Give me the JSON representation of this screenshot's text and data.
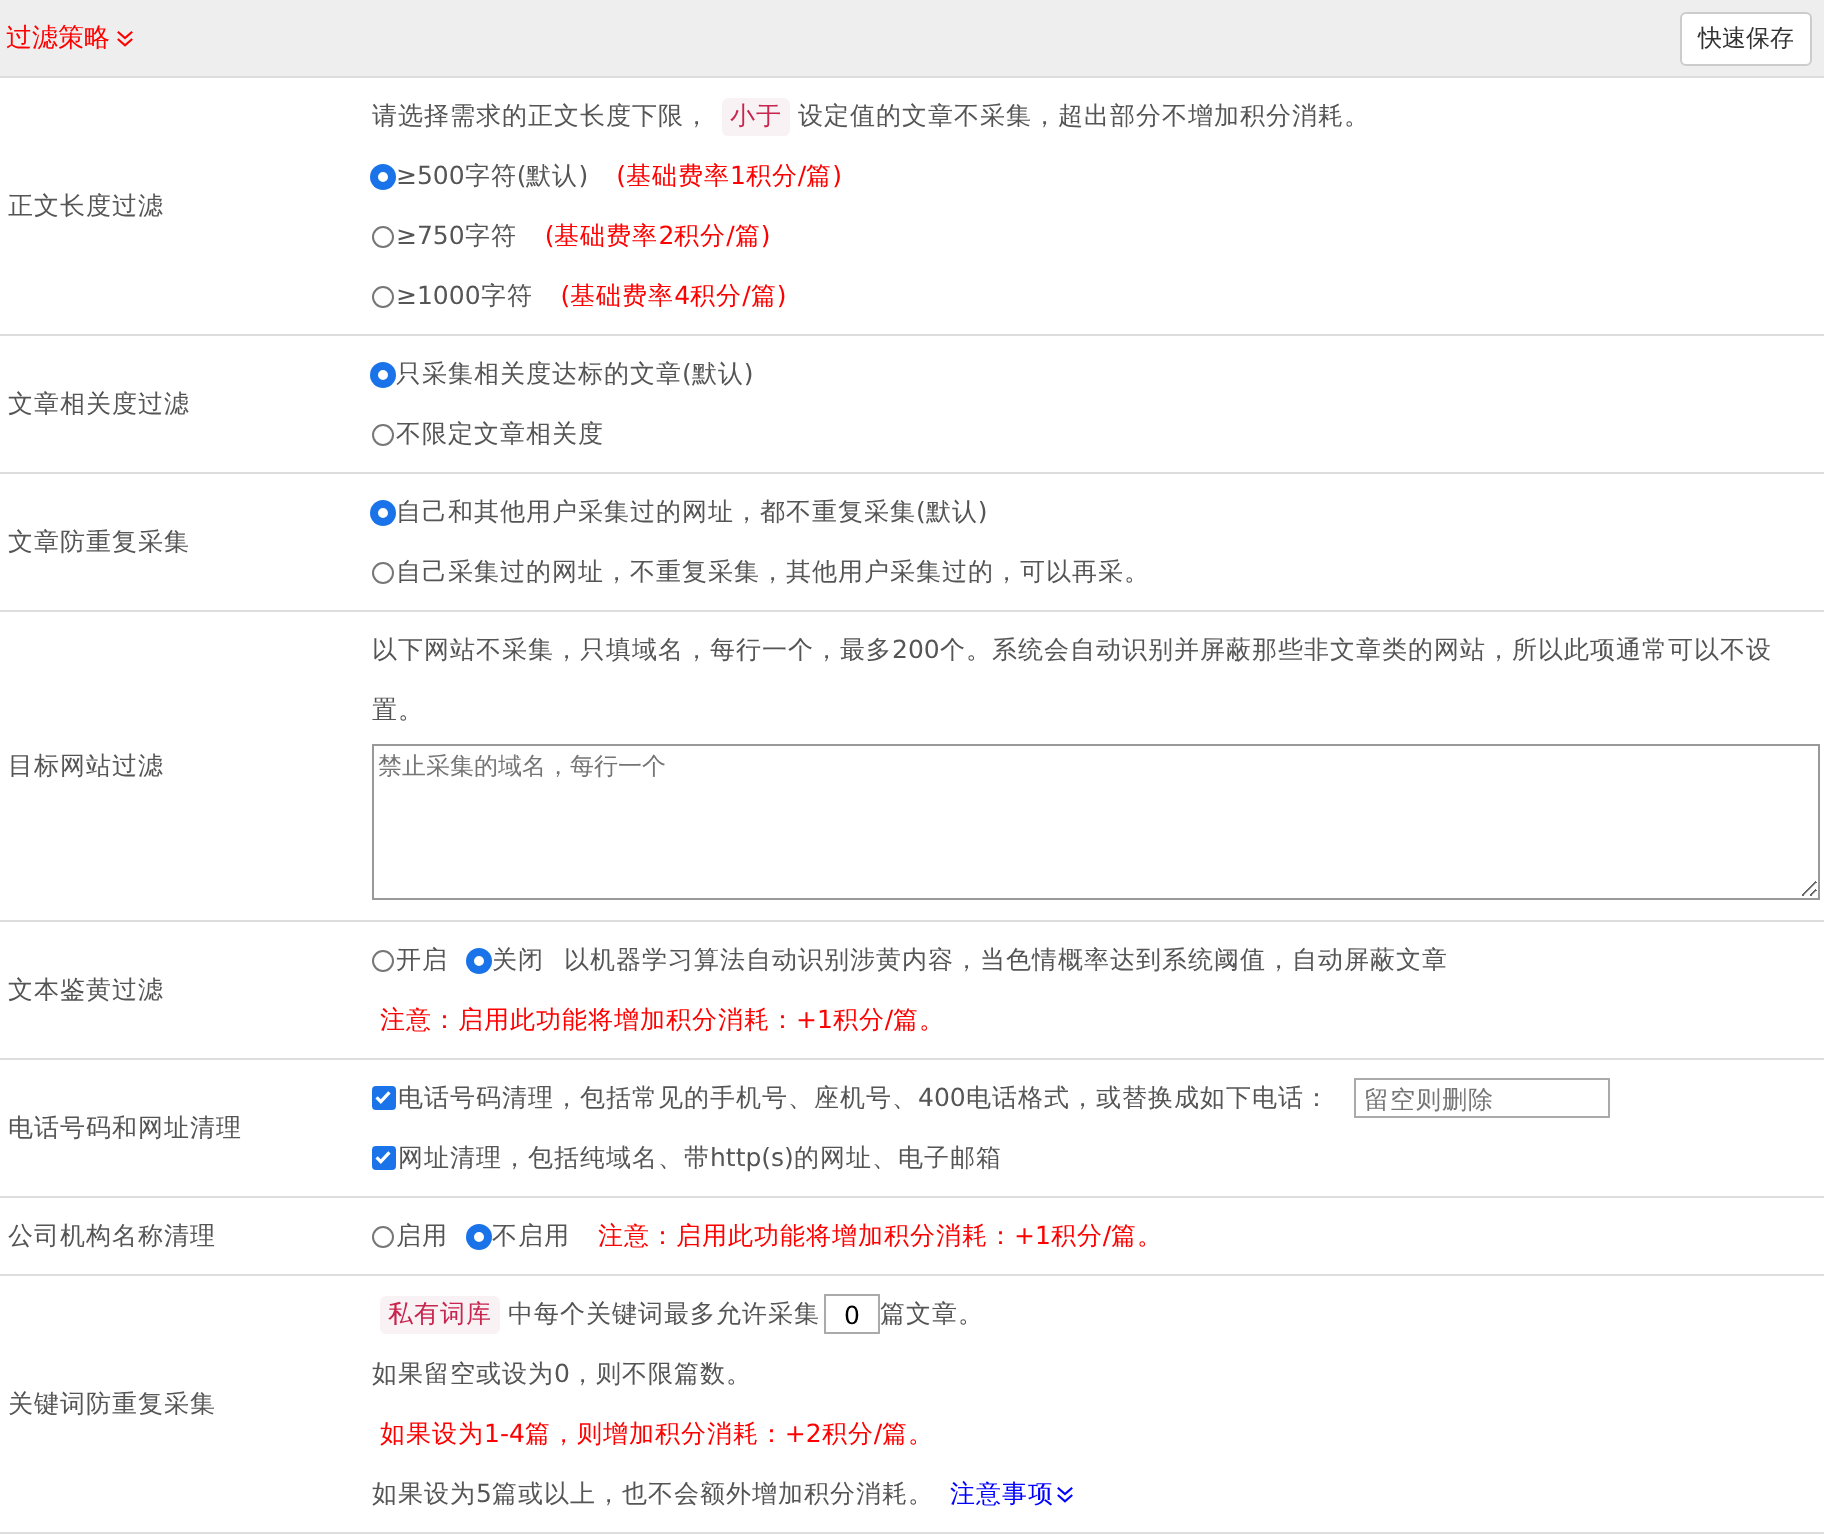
{
  "header": {
    "title": "过滤策略",
    "button": "快速保存"
  },
  "rows": [
    {
      "label": "正文长度过滤",
      "lines": [
        [
          {
            "kind": "text",
            "text": "请选择需求的正文长度下限，"
          },
          {
            "kind": "tag",
            "text": "小于"
          },
          {
            "kind": "text",
            "text": "设定值的文章不采集，超出部分不增加积分消耗。"
          }
        ],
        [
          {
            "kind": "radio",
            "label": "≥500字符(默认)",
            "selected": true
          },
          {
            "kind": "note",
            "text": "(基础费率1积分/篇)"
          }
        ],
        [
          {
            "kind": "radio",
            "label": "≥750字符",
            "selected": false
          },
          {
            "kind": "note",
            "text": "(基础费率2积分/篇)"
          }
        ],
        [
          {
            "kind": "radio",
            "label": "≥1000字符",
            "selected": false
          },
          {
            "kind": "note",
            "text": "(基础费率4积分/篇)"
          }
        ]
      ]
    },
    {
      "label": "文章相关度过滤",
      "lines": [
        [
          {
            "kind": "radio",
            "label": "只采集相关度达标的文章(默认)",
            "selected": true
          }
        ],
        [
          {
            "kind": "radio",
            "label": "不限定文章相关度",
            "selected": false
          }
        ]
      ]
    },
    {
      "label": "文章防重复采集",
      "lines": [
        [
          {
            "kind": "radio",
            "label": "自己和其他用户采集过的网址，都不重复采集(默认)",
            "selected": true
          }
        ],
        [
          {
            "kind": "radio",
            "label": "自己采集过的网址，不重复采集，其他用户采集过的，可以再采。",
            "selected": false
          }
        ]
      ]
    },
    {
      "label": "目标网站过滤",
      "lines": [
        [
          {
            "kind": "text",
            "text": "以下网站不采集，只填域名，每行一个，最多200个。系统会自动识别并屏蔽那些非文章类的网站，所以此项通常可以不设置。"
          }
        ],
        [
          {
            "kind": "textarea",
            "placeholder": "禁止采集的域名，每行一个"
          }
        ]
      ]
    },
    {
      "label": "文本鉴黄过滤",
      "lines": [
        [
          {
            "kind": "radio",
            "label": "开启",
            "selected": false
          },
          {
            "kind": "radio",
            "label": "关闭",
            "selected": true
          },
          {
            "kind": "text",
            "text": "以机器学习算法自动识别涉黄内容，当色情概率达到系统阈值，自动屏蔽文章"
          }
        ],
        [
          {
            "kind": "note",
            "text": "注意：启用此功能将增加积分消耗：+1积分/篇。"
          }
        ]
      ]
    },
    {
      "label": "电话号码和网址清理",
      "lines": [
        [
          {
            "kind": "checkbox",
            "label": "电话号码清理，包括常见的手机号、座机号、400电话格式，或替换成如下电话：",
            "checked": true
          },
          {
            "kind": "input",
            "placeholder": "留空则删除"
          }
        ],
        [
          {
            "kind": "checkbox",
            "label": "网址清理，包括纯域名、带http(s)的网址、电子邮箱",
            "checked": true
          }
        ]
      ]
    },
    {
      "label": "公司机构名称清理",
      "lines": [
        [
          {
            "kind": "radio",
            "label": "启用",
            "selected": false
          },
          {
            "kind": "radio",
            "label": "不启用",
            "selected": true
          },
          {
            "kind": "note",
            "text": "注意：启用此功能将增加积分消耗：+1积分/篇。"
          }
        ]
      ]
    },
    {
      "label": "关键词防重复采集",
      "lines": [
        [
          {
            "kind": "tag",
            "text": "私有词库"
          },
          {
            "kind": "text",
            "text": "中每个关键词最多允许采集"
          },
          {
            "kind": "number",
            "value": "0"
          },
          {
            "kind": "text",
            "text": "篇文章。"
          }
        ],
        [
          {
            "kind": "text",
            "text": "如果留空或设为0，则不限篇数。"
          }
        ],
        [
          {
            "kind": "note",
            "text": "如果设为1-4篇，则增加积分消耗：+2积分/篇。"
          }
        ],
        [
          {
            "kind": "text",
            "text": "如果设为5篇或以上，也不会额外增加积分消耗。"
          },
          {
            "kind": "link",
            "text": "注意事项"
          }
        ]
      ]
    }
  ]
}
